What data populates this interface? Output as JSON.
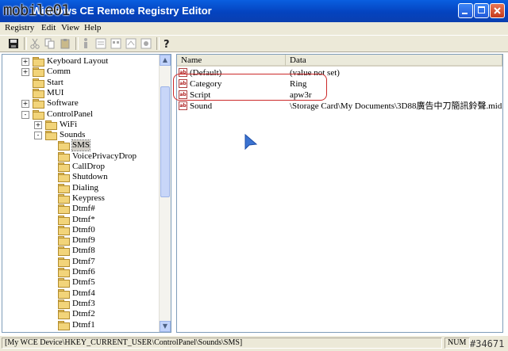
{
  "window": {
    "title": "Windows CE Remote Registry Editor",
    "watermark": "mobile01"
  },
  "menu": [
    "Registry",
    "Edit",
    "View",
    "Help"
  ],
  "toolbar_icons": [
    "save-icon",
    "cut-icon",
    "copy-icon",
    "paste-icon",
    "import-icon",
    "export-icon",
    "key-icon",
    "connect-icon",
    "disconnect-icon",
    "help-icon"
  ],
  "tree": [
    {
      "label": "Keyboard Layout",
      "level": 1,
      "exp": "+"
    },
    {
      "label": "Comm",
      "level": 1,
      "exp": "+"
    },
    {
      "label": "Start",
      "level": 1,
      "exp": ""
    },
    {
      "label": "MUI",
      "level": 1,
      "exp": ""
    },
    {
      "label": "Software",
      "level": 1,
      "exp": "+"
    },
    {
      "label": "ControlPanel",
      "level": 1,
      "exp": "-"
    },
    {
      "label": "WiFi",
      "level": 2,
      "exp": "+"
    },
    {
      "label": "Sounds",
      "level": 2,
      "exp": "-"
    },
    {
      "label": "SMS",
      "level": 3,
      "exp": "",
      "selected": true
    },
    {
      "label": "VoicePrivacyDrop",
      "level": 3,
      "exp": ""
    },
    {
      "label": "CallDrop",
      "level": 3,
      "exp": ""
    },
    {
      "label": "Shutdown",
      "level": 3,
      "exp": ""
    },
    {
      "label": "Dialing",
      "level": 3,
      "exp": ""
    },
    {
      "label": "Keypress",
      "level": 3,
      "exp": ""
    },
    {
      "label": "Dtmf#",
      "level": 3,
      "exp": ""
    },
    {
      "label": "Dtmf*",
      "level": 3,
      "exp": ""
    },
    {
      "label": "Dtmf0",
      "level": 3,
      "exp": ""
    },
    {
      "label": "Dtmf9",
      "level": 3,
      "exp": ""
    },
    {
      "label": "Dtmf8",
      "level": 3,
      "exp": ""
    },
    {
      "label": "Dtmf7",
      "level": 3,
      "exp": ""
    },
    {
      "label": "Dtmf6",
      "level": 3,
      "exp": ""
    },
    {
      "label": "Dtmf5",
      "level": 3,
      "exp": ""
    },
    {
      "label": "Dtmf4",
      "level": 3,
      "exp": ""
    },
    {
      "label": "Dtmf3",
      "level": 3,
      "exp": ""
    },
    {
      "label": "Dtmf2",
      "level": 3,
      "exp": ""
    },
    {
      "label": "Dtmf1",
      "level": 3,
      "exp": ""
    }
  ],
  "list": {
    "headers": [
      "Name",
      "Data"
    ],
    "rows": [
      {
        "name": "(Default)",
        "data": "(value not set)"
      },
      {
        "name": "Category",
        "data": "Ring"
      },
      {
        "name": "Script",
        "data": "apw3r"
      },
      {
        "name": "Sound",
        "data": "\\Storage Card\\My Documents\\3D88廣告中刀簡訊鈴聲.mid"
      }
    ]
  },
  "status": {
    "path": "[My WCE Device\\HKEY_CURRENT_USER\\ControlPanel\\Sounds\\SMS]",
    "num": "NUM",
    "image_id": "#34671"
  },
  "colors": {
    "title_bar": "#0443bf",
    "highlight_outline": "#cc2a2a",
    "cursor": "#3b73d1"
  }
}
